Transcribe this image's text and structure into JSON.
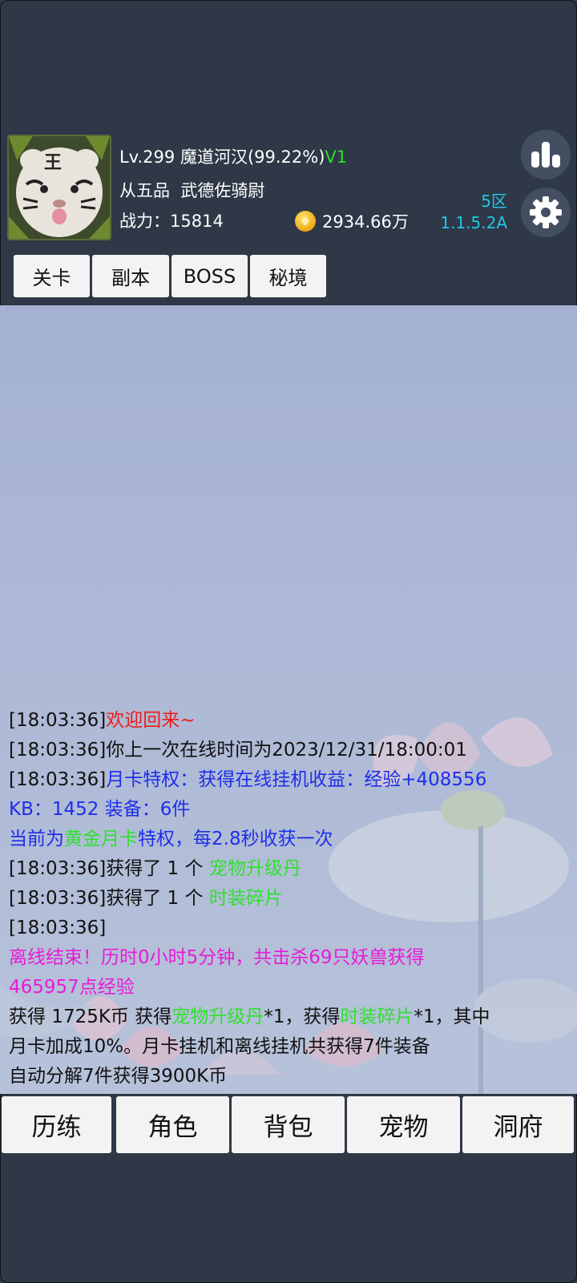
{
  "header": {
    "level": "Lv.299",
    "player_name": "魔道河汉",
    "exp_percent": "(99.22%)",
    "vip": "V1",
    "rank_grade": "从五品",
    "rank_title": "武德佐骑尉",
    "power_label": "战力：",
    "power_value": "15814",
    "gold": "2934.66万",
    "server_zone": "5区",
    "version": "1.1.5.2A",
    "avatar_text": "王"
  },
  "tabs": [
    "关卡",
    "副本",
    "BOSS",
    "秘境"
  ],
  "log": [
    [
      {
        "t": "[18:03:36]"
      },
      {
        "t": "欢迎回来~",
        "c": "red"
      }
    ],
    [
      {
        "t": "[18:03:36]你上一次在线时间为2023/12/31/18:00:01"
      }
    ],
    [
      {
        "t": "[18:03:36]"
      },
      {
        "t": "月卡特权：获得在线挂机收益：经验+408556",
        "c": "blue"
      }
    ],
    [
      {
        "t": "KB：1452 装备：6件",
        "c": "blue"
      }
    ],
    [
      {
        "t": "当前为",
        "c": "blue"
      },
      {
        "t": "黄金月卡",
        "c": "green"
      },
      {
        "t": "特权，每2.8秒收获一次",
        "c": "blue"
      }
    ],
    [
      {
        "t": "[18:03:36]获得了 1 个 "
      },
      {
        "t": "宠物升级丹",
        "c": "green"
      }
    ],
    [
      {
        "t": "[18:03:36]获得了 1 个 "
      },
      {
        "t": "时装碎片",
        "c": "green"
      }
    ],
    [
      {
        "t": "[18:03:36]"
      }
    ],
    [
      {
        "t": "离线结束！历时0小时5分钟，共击杀69只妖兽获得",
        "c": "magenta"
      }
    ],
    [
      {
        "t": "465957点经验",
        "c": "magenta"
      }
    ],
    [
      {
        "t": "获得 1725K币 获得"
      },
      {
        "t": "宠物升级丹",
        "c": "green"
      },
      {
        "t": "*1，获得"
      },
      {
        "t": "时装碎片",
        "c": "green"
      },
      {
        "t": "*1，其中"
      }
    ],
    [
      {
        "t": "月卡加成10%。月卡挂机和离线挂机共获得7件装备"
      }
    ],
    [
      {
        "t": "自动分解7件获得3900K币"
      }
    ]
  ],
  "bottom_nav": [
    "历练",
    "角色",
    "背包",
    "宠物",
    "洞府"
  ],
  "colors": {
    "background": "#2e3847",
    "panel": "#aebad6",
    "red": "#ee1b1b",
    "blue": "#1e2ee8",
    "green": "#2fe02f",
    "magenta": "#e71cd6",
    "server": "#22c6e6"
  },
  "icons": [
    "stats-icon",
    "gear-icon",
    "coin-icon"
  ]
}
